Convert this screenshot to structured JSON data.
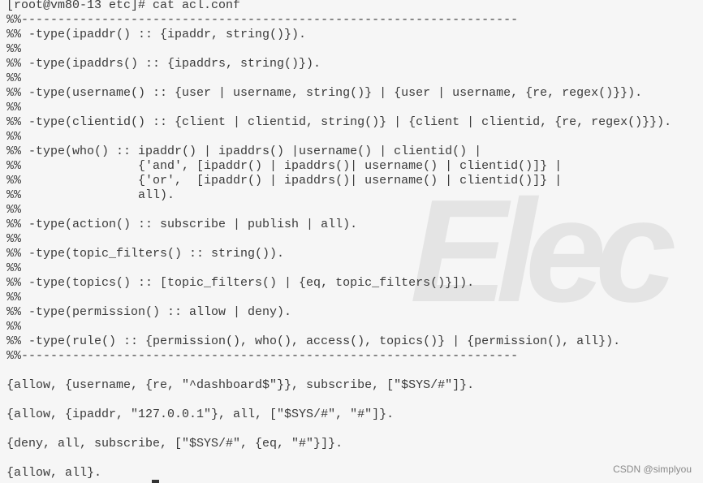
{
  "terminal": {
    "lines": [
      "[root@vm80-13 etc]# cat acl.conf",
      "%%--------------------------------------------------------------------",
      "%% -type(ipaddr() :: {ipaddr, string()}).",
      "%%",
      "%% -type(ipaddrs() :: {ipaddrs, string()}).",
      "%%",
      "%% -type(username() :: {user | username, string()} | {user | username, {re, regex()}}).",
      "%%",
      "%% -type(clientid() :: {client | clientid, string()} | {client | clientid, {re, regex()}}).",
      "%%",
      "%% -type(who() :: ipaddr() | ipaddrs() |username() | clientid() |",
      "%%                {'and', [ipaddr() | ipaddrs()| username() | clientid()]} |",
      "%%                {'or',  [ipaddr() | ipaddrs()| username() | clientid()]} |",
      "%%                all).",
      "%%",
      "%% -type(action() :: subscribe | publish | all).",
      "%%",
      "%% -type(topic_filters() :: string()).",
      "%%",
      "%% -type(topics() :: [topic_filters() | {eq, topic_filters()}]).",
      "%%",
      "%% -type(permission() :: allow | deny).",
      "%%",
      "%% -type(rule() :: {permission(), who(), access(), topics()} | {permission(), all}).",
      "%%--------------------------------------------------------------------",
      "",
      "{allow, {username, {re, \"^dashboard$\"}}, subscribe, [\"$SYS/#\"]}.",
      "",
      "{allow, {ipaddr, \"127.0.0.1\"}, all, [\"$SYS/#\", \"#\"]}.",
      "",
      "{deny, all, subscribe, [\"$SYS/#\", {eq, \"#\"}]}.",
      "",
      "{allow, all}."
    ]
  },
  "watermark": "Elec",
  "credit": "CSDN @simplyou"
}
